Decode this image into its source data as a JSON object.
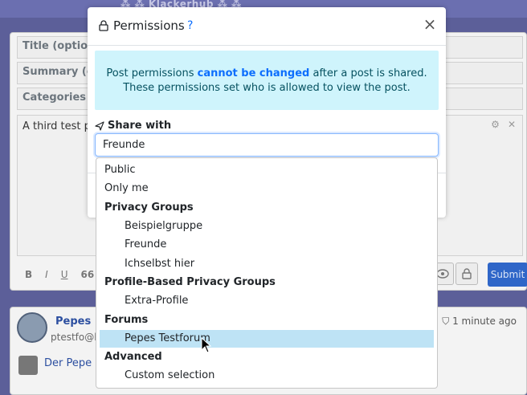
{
  "background": {
    "brand": "⁂ ⁂ Klackerhub ⁂ ⁂",
    "fields": [
      {
        "label": "Title (optional)"
      },
      {
        "label": "Summary (opt"
      },
      {
        "label": "Categories (op"
      }
    ],
    "body_text": "A third test pos",
    "toolbar": {
      "bold": "B",
      "italic": "I",
      "underline": "U",
      "quote": "66",
      "submit": "Submit"
    },
    "post": {
      "author": "Pepes",
      "handle": "ptestfo@k",
      "time": "1 minute ago",
      "link": "Der Pepe"
    }
  },
  "modal": {
    "title": "Permissions",
    "help": "?",
    "close": "×",
    "info_prefix": "Post permissions ",
    "info_emph": "cannot be changed",
    "info_suffix": " after a post is shared.",
    "info_line2": "These permissions set who is allowed to view the post.",
    "share_label": "Share with",
    "share_value": "Freunde"
  },
  "dropdown": {
    "items": [
      {
        "label": "Public",
        "kind": "item"
      },
      {
        "label": "Only me",
        "kind": "item"
      },
      {
        "label": "Privacy Groups",
        "kind": "group"
      },
      {
        "label": "Beispielgruppe",
        "kind": "sub"
      },
      {
        "label": "Freunde",
        "kind": "sub"
      },
      {
        "label": "Ichselbst hier",
        "kind": "sub"
      },
      {
        "label": "Profile-Based Privacy Groups",
        "kind": "group"
      },
      {
        "label": "Extra-Profile",
        "kind": "sub"
      },
      {
        "label": "Forums",
        "kind": "group"
      },
      {
        "label": "Pepes Testforum",
        "kind": "sub",
        "selected": true
      },
      {
        "label": "Advanced",
        "kind": "group"
      },
      {
        "label": "Custom selection",
        "kind": "sub"
      }
    ]
  },
  "colors": {
    "accent": "#0d6efd",
    "info_bg": "#cff4fc",
    "selected_bg": "#bee3f5",
    "submit": "#2f66c8"
  }
}
